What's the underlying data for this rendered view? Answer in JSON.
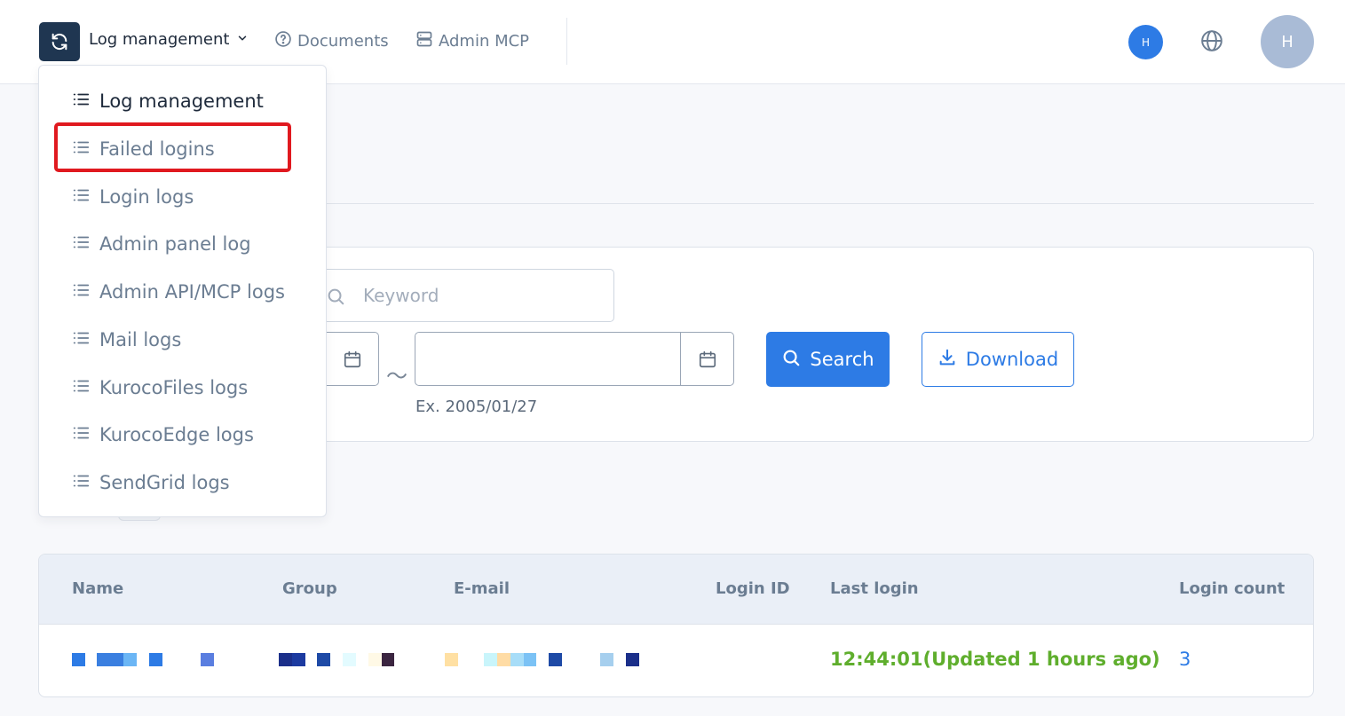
{
  "header": {
    "current_menu": "Log management",
    "nav_documents": "Documents",
    "nav_admin_mcp": "Admin MCP",
    "user_initial_small": "H",
    "user_initial_large": "H",
    "accent_color": "#2d7be5",
    "icons": [
      "refresh-icon",
      "chevron-down-icon",
      "help-circle-icon",
      "server-icon",
      "globe-icon"
    ]
  },
  "dropdown": {
    "items": [
      {
        "label": "Log management",
        "active": true
      },
      {
        "label": "Failed logins",
        "highlighted": true
      },
      {
        "label": "Login logs"
      },
      {
        "label": "Admin panel log"
      },
      {
        "label": "Admin API/MCP logs"
      },
      {
        "label": "Mail logs"
      },
      {
        "label": "KurocoFiles logs"
      },
      {
        "label": "KurocoEdge logs"
      },
      {
        "label": "SendGrid logs"
      }
    ]
  },
  "search": {
    "keyword_placeholder": "Keyword",
    "date_separator": "～",
    "date_hint": "Ex. 2005/01/27",
    "search_label": "Search",
    "download_label": "Download"
  },
  "table": {
    "headers": [
      "Name",
      "Group",
      "E-mail",
      "Login ID",
      "Last login",
      "Login count"
    ],
    "rows": [
      {
        "last_login": "12:44:01(Updated 1 hours ago)",
        "login_count": "3"
      }
    ]
  }
}
